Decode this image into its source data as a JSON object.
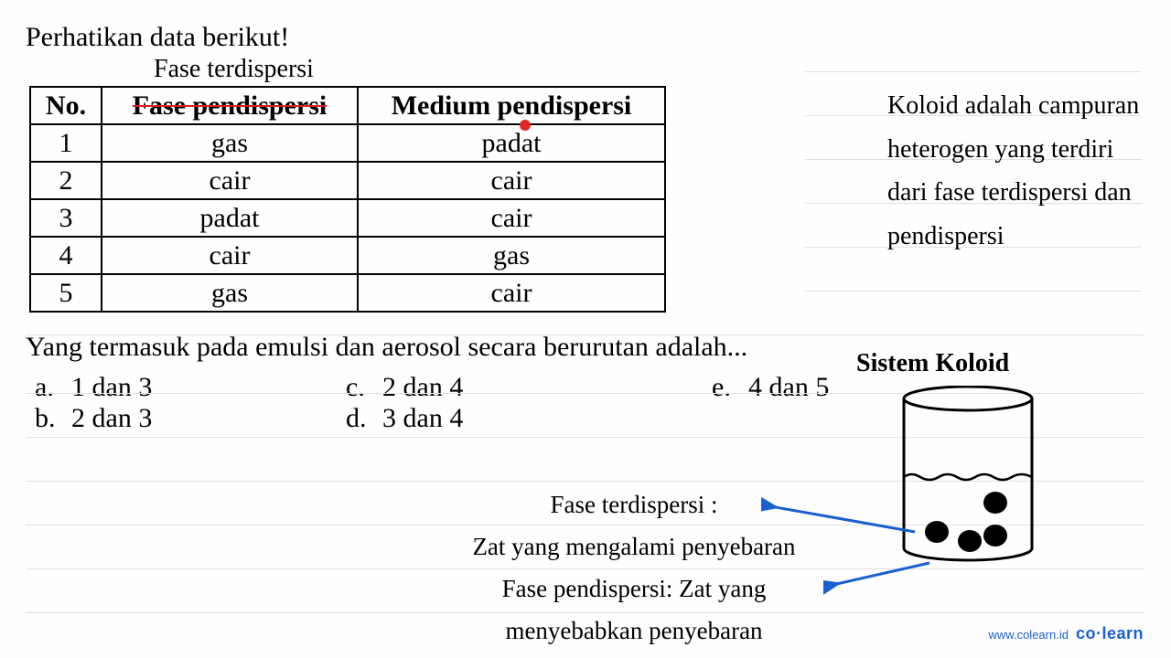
{
  "title": "Perhatikan data berikut!",
  "subtitle": "Fase terdispersi",
  "table": {
    "headers": {
      "no": "No.",
      "fase": "Fase pendispersi",
      "medium": "Medium pendispersi"
    },
    "rows": [
      {
        "no": "1",
        "fase": "gas",
        "medium": "padat"
      },
      {
        "no": "2",
        "fase": "cair",
        "medium": "cair"
      },
      {
        "no": "3",
        "fase": "padat",
        "medium": "cair"
      },
      {
        "no": "4",
        "fase": "cair",
        "medium": "gas"
      },
      {
        "no": "5",
        "fase": "gas",
        "medium": "cair"
      }
    ]
  },
  "definition_side": "Koloid adalah campuran heterogen yang terdiri dari fase terdispersi dan pendispersi",
  "question": "Yang termasuk pada emulsi dan aerosol secara berurutan adalah...",
  "options": {
    "a": {
      "label": "a.",
      "text": "1 dan 3"
    },
    "b": {
      "label": "b.",
      "text": "2 dan 3"
    },
    "c": {
      "label": "c.",
      "text": "2 dan 4"
    },
    "d": {
      "label": "d.",
      "text": "3 dan 4"
    },
    "e": {
      "label": "e.",
      "text": "4 dan 5"
    }
  },
  "sistem_koloid_title": "Sistem Koloid",
  "bottom_defs": {
    "l1": "Fase terdispersi :",
    "l2": "Zat yang mengalami penyebaran",
    "l3": "Fase pendispersi:  Zat yang",
    "l4": "menyebabkan penyebaran"
  },
  "watermark": {
    "url": "www.colearn.id",
    "brand_a": "co",
    "brand_dot": "·",
    "brand_b": "learn"
  },
  "chart_data": {
    "type": "table",
    "title": "Fase terdispersi dan medium pendispersi",
    "headers": [
      "No.",
      "Fase pendispersi",
      "Medium pendispersi"
    ],
    "rows": [
      [
        "1",
        "gas",
        "padat"
      ],
      [
        "2",
        "cair",
        "cair"
      ],
      [
        "3",
        "padat",
        "cair"
      ],
      [
        "4",
        "cair",
        "gas"
      ],
      [
        "5",
        "gas",
        "cair"
      ]
    ]
  }
}
